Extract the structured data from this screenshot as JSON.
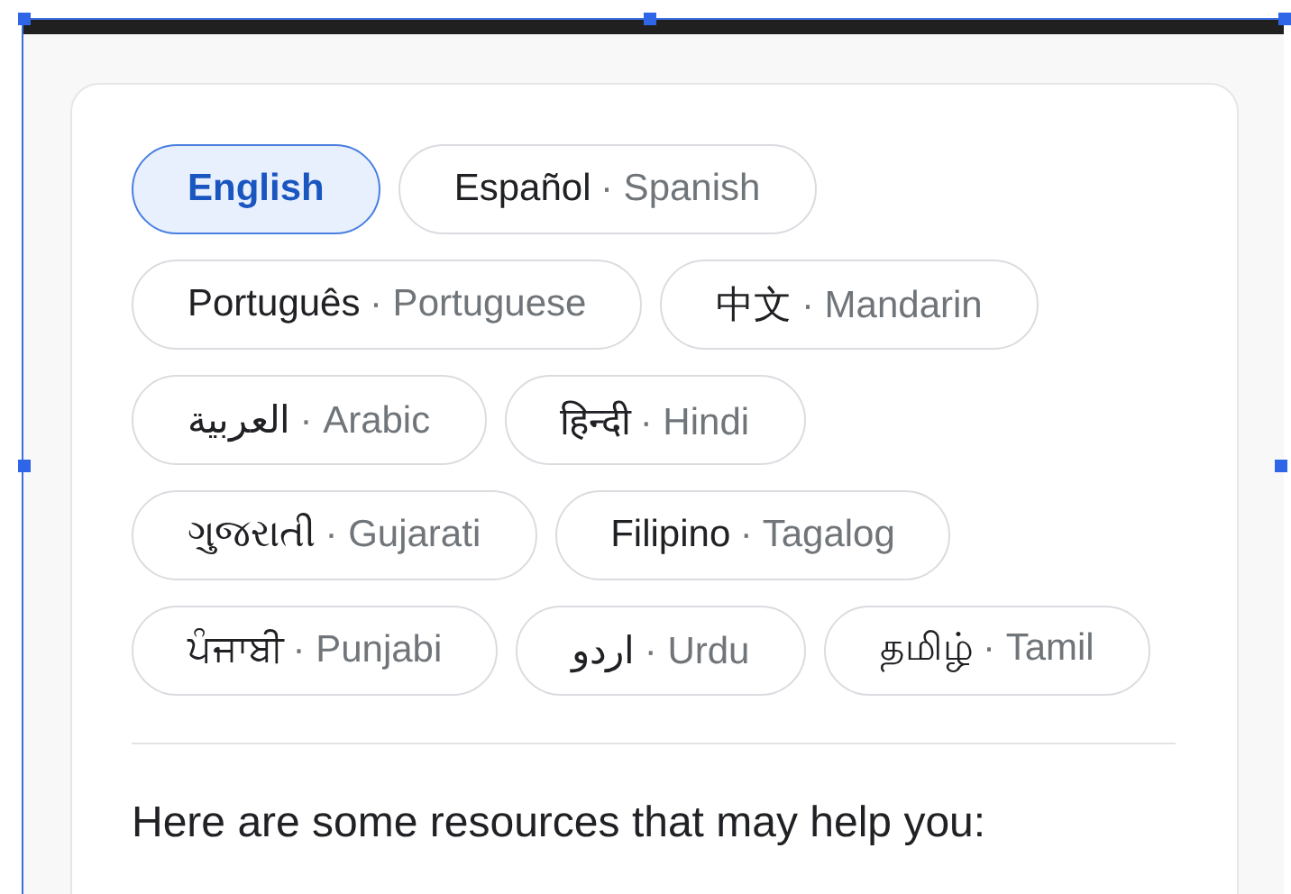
{
  "languages": [
    {
      "native": "English",
      "selected": true
    },
    {
      "native": "Español",
      "english": "· Spanish",
      "selected": false
    },
    {
      "native": "Português",
      "english": "· Portuguese",
      "selected": false
    },
    {
      "native": "中文",
      "english": "· Mandarin",
      "selected": false
    },
    {
      "native": "العربية",
      "english": "· Arabic",
      "selected": false
    },
    {
      "native": "हिन्दी",
      "english": "· Hindi",
      "selected": false
    },
    {
      "native": "ગુજરાતી",
      "english": "· Gujarati",
      "selected": false
    },
    {
      "native": "Filipino",
      "english": "· Tagalog",
      "selected": false
    },
    {
      "native": "ਪੰਜਾਬੀ",
      "english": "· Punjabi",
      "selected": false
    },
    {
      "native": "اردو",
      "english": "· Urdu",
      "selected": false
    },
    {
      "native": "தமிழ்",
      "english": "· Tamil",
      "selected": false
    }
  ],
  "resources_heading": "Here are some resources that may help you:"
}
